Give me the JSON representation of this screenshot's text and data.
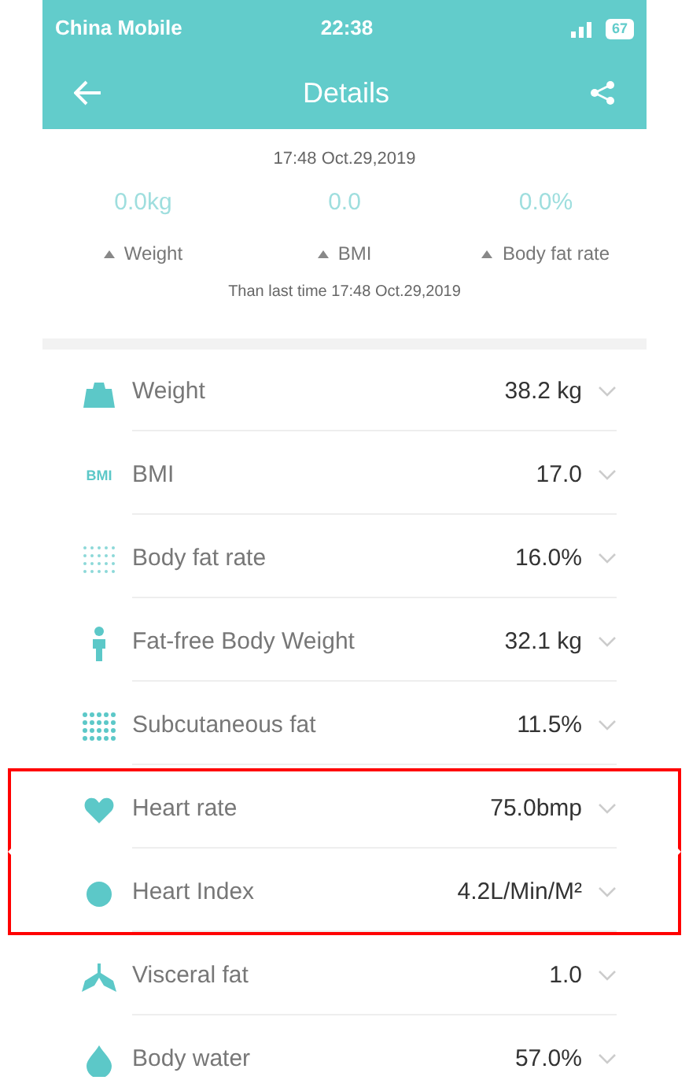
{
  "status_bar": {
    "carrier": "China Mobile",
    "time": "22:38",
    "battery": "67"
  },
  "header": {
    "title": "Details"
  },
  "summary": {
    "date": "17:48 Oct.29,2019",
    "stats": [
      {
        "value": "0.0kg",
        "label": "Weight"
      },
      {
        "value": "0.0",
        "label": "BMI"
      },
      {
        "value": "0.0%",
        "label": "Body fat rate"
      }
    ],
    "compare": "Than last time 17:48 Oct.29,2019"
  },
  "metrics": [
    {
      "kind": "weight",
      "name": "Weight",
      "value": "38.2 kg",
      "highlighted": false
    },
    {
      "kind": "bmi",
      "icon_text": "BMI",
      "name": "BMI",
      "value": "17.0",
      "highlighted": false
    },
    {
      "kind": "fat",
      "name": "Body fat rate",
      "value": "16.0%",
      "highlighted": false
    },
    {
      "kind": "person",
      "name": "Fat-free Body Weight",
      "value": "32.1 kg",
      "highlighted": false
    },
    {
      "kind": "grid",
      "name": "Subcutaneous fat",
      "value": "11.5%",
      "highlighted": false
    },
    {
      "kind": "heart",
      "name": "Heart rate",
      "value": "75.0bmp",
      "highlighted": true
    },
    {
      "kind": "circle",
      "name": "Heart Index",
      "value": "4.2L/Min/M²",
      "highlighted": true
    },
    {
      "kind": "lungs",
      "name": "Visceral fat",
      "value": "1.0",
      "highlighted": false
    },
    {
      "kind": "drop",
      "name": "Body water",
      "value": "57.0%",
      "highlighted": false
    }
  ]
}
